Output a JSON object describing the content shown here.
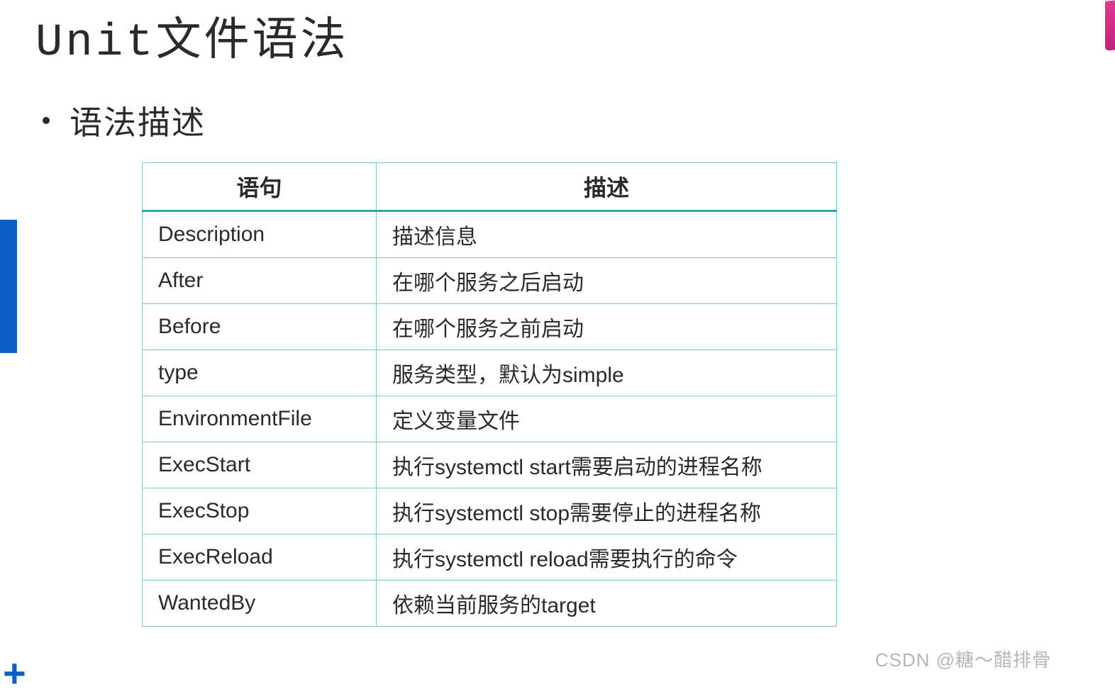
{
  "title": "Unit文件语法",
  "bullet": "语法描述",
  "table": {
    "headers": [
      "语句",
      "描述"
    ],
    "rows": [
      {
        "stmt": "Description",
        "desc": "描述信息"
      },
      {
        "stmt": "After",
        "desc": "在哪个服务之后启动"
      },
      {
        "stmt": "Before",
        "desc": "在哪个服务之前启动"
      },
      {
        "stmt": "type",
        "desc": "服务类型，默认为simple"
      },
      {
        "stmt": "EnvironmentFile",
        "desc": "定义变量文件"
      },
      {
        "stmt": "ExecStart",
        "desc": "执行systemctl start需要启动的进程名称"
      },
      {
        "stmt": "ExecStop",
        "desc": "执行systemctl stop需要停止的进程名称"
      },
      {
        "stmt": "ExecReload",
        "desc": "执行systemctl reload需要执行的命令"
      },
      {
        "stmt": "WantedBy",
        "desc": "依赖当前服务的target"
      }
    ]
  },
  "watermark": "CSDN @糖～醋排骨"
}
